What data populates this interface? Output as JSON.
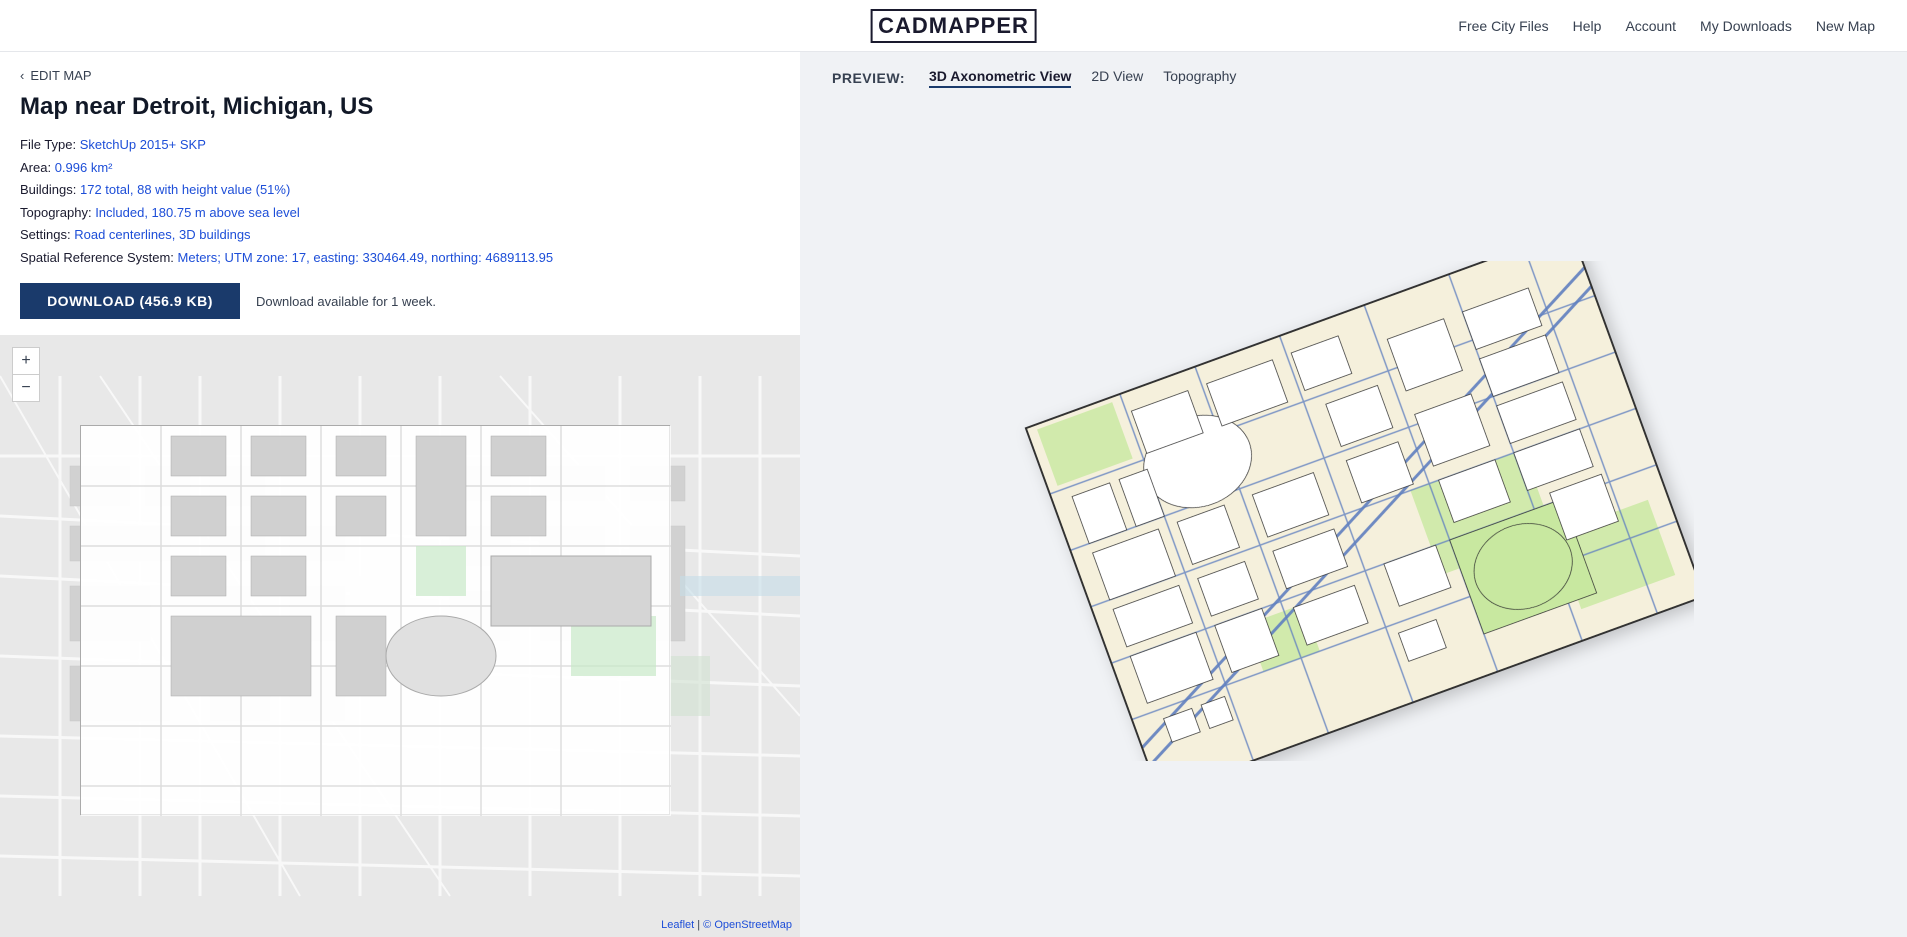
{
  "header": {
    "logo": "CADMAPPER",
    "logo_cad": "CAD",
    "logo_mapper": "MAPPER",
    "nav_items": [
      {
        "label": "Free City Files",
        "id": "free-city-files"
      },
      {
        "label": "Help",
        "id": "help"
      },
      {
        "label": "Account",
        "id": "account"
      },
      {
        "label": "My Downloads",
        "id": "my-downloads"
      },
      {
        "label": "New Map",
        "id": "new-map"
      }
    ]
  },
  "left_panel": {
    "edit_map_link": "EDIT MAP",
    "map_title": "Map near Detroit, Michigan, US",
    "file_type_label": "File Type:",
    "file_type_value": "SketchUp 2015+ SKP",
    "area_label": "Area:",
    "area_value": "0.996 km²",
    "buildings_label": "Buildings:",
    "buildings_value": "172 total, 88 with height value (51%)",
    "topography_label": "Topography:",
    "topography_value": "Included, 180.75 m above sea level",
    "settings_label": "Settings:",
    "settings_value": "Road centerlines, 3D buildings",
    "srs_label": "Spatial Reference System:",
    "srs_value": "Meters; UTM zone: 17, easting: 330464.49, northing: 4689113.95",
    "download_btn": "DOWNLOAD (456.9 KB)",
    "download_note": "Download available for 1 week.",
    "zoom_in": "+",
    "zoom_out": "−",
    "attribution_leaflet": "Leaflet",
    "attribution_osm": "© OpenStreetMap"
  },
  "preview": {
    "label": "PREVIEW:",
    "tabs": [
      {
        "label": "3D Axonometric View",
        "id": "3d-axonometric",
        "active": true
      },
      {
        "label": "2D View",
        "id": "2d-view",
        "active": false
      },
      {
        "label": "Topography",
        "id": "topography",
        "active": false
      }
    ]
  }
}
